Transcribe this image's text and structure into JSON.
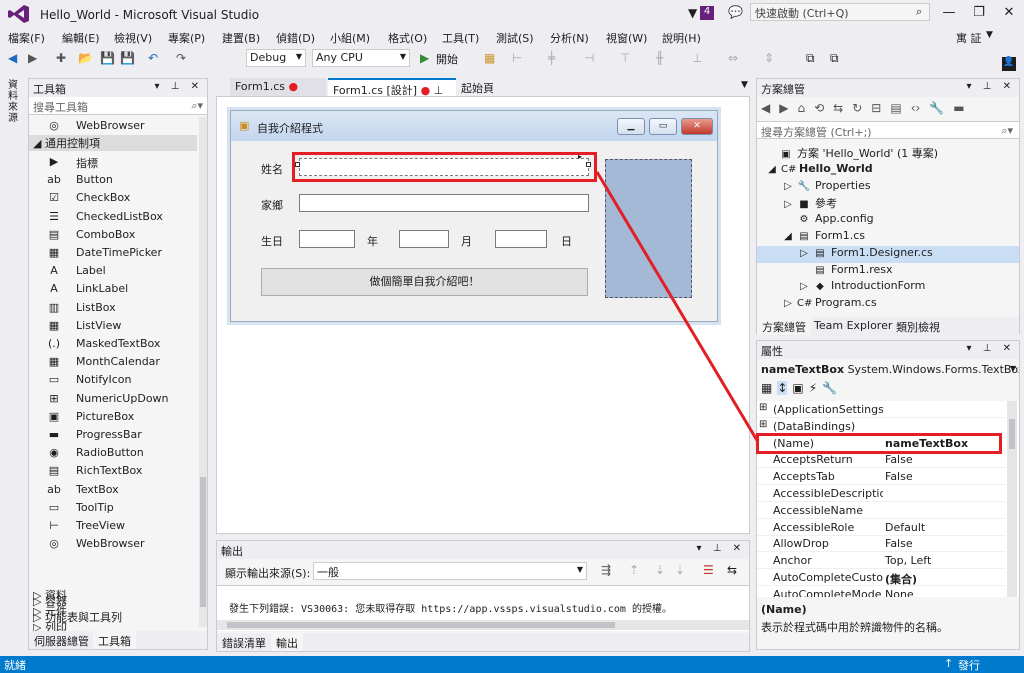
{
  "window": {
    "title": "Hello_World - Microsoft Visual Studio",
    "notif_count": "4",
    "quick_launch_placeholder": "快速啟動 (Ctrl+Q)",
    "user": "寓 証"
  },
  "menu": [
    "檔案(F)",
    "編輯(E)",
    "檢視(V)",
    "專案(P)",
    "建置(B)",
    "偵錯(D)",
    "小組(M)",
    "格式(O)",
    "工具(T)",
    "測試(S)",
    "分析(N)",
    "視窗(W)",
    "說明(H)"
  ],
  "toolbar": {
    "config": "Debug",
    "platform": "Any CPU",
    "start_label": "開始"
  },
  "left_strip_label": "資料來源",
  "toolbox": {
    "title": "工具箱",
    "search_placeholder": "搜尋工具箱",
    "top_item": "WebBrowser",
    "group_common": "◢ 通用控制項",
    "items": [
      {
        "icon": "▶",
        "label": "指標",
        "icon_name": "pointer-icon"
      },
      {
        "icon": "ab",
        "label": "Button",
        "icon_name": "button-icon"
      },
      {
        "icon": "☑",
        "label": "CheckBox",
        "icon_name": "checkbox-icon"
      },
      {
        "icon": "☰",
        "label": "CheckedListBox",
        "icon_name": "checkedlistbox-icon"
      },
      {
        "icon": "▤",
        "label": "ComboBox",
        "icon_name": "combobox-icon"
      },
      {
        "icon": "▦",
        "label": "DateTimePicker",
        "icon_name": "datetimepicker-icon"
      },
      {
        "icon": "A",
        "label": "Label",
        "icon_name": "label-icon"
      },
      {
        "icon": "A",
        "label": "LinkLabel",
        "icon_name": "linklabel-icon"
      },
      {
        "icon": "▥",
        "label": "ListBox",
        "icon_name": "listbox-icon"
      },
      {
        "icon": "▦",
        "label": "ListView",
        "icon_name": "listview-icon"
      },
      {
        "icon": "(.)",
        "label": "MaskedTextBox",
        "icon_name": "maskedtextbox-icon"
      },
      {
        "icon": "▦",
        "label": "MonthCalendar",
        "icon_name": "monthcalendar-icon"
      },
      {
        "icon": "▭",
        "label": "NotifyIcon",
        "icon_name": "notifyicon-icon"
      },
      {
        "icon": "⊞",
        "label": "NumericUpDown",
        "icon_name": "numericupdown-icon"
      },
      {
        "icon": "▣",
        "label": "PictureBox",
        "icon_name": "picturebox-icon"
      },
      {
        "icon": "▬",
        "label": "ProgressBar",
        "icon_name": "progressbar-icon"
      },
      {
        "icon": "◉",
        "label": "RadioButton",
        "icon_name": "radiobutton-icon"
      },
      {
        "icon": "▤",
        "label": "RichTextBox",
        "icon_name": "richtextbox-icon"
      },
      {
        "icon": "ab",
        "label": "TextBox",
        "icon_name": "textbox-icon"
      },
      {
        "icon": "▭",
        "label": "ToolTip",
        "icon_name": "tooltip-icon"
      },
      {
        "icon": "⊢",
        "label": "TreeView",
        "icon_name": "treeview-icon"
      },
      {
        "icon": "◎",
        "label": "WebBrowser",
        "icon_name": "webbrowser-icon"
      }
    ],
    "groups": [
      "▷ 容器",
      "▷ 功能表與工具列",
      "▷ 資料",
      "▷ 元件",
      "▷ 列印"
    ],
    "bottom_tabs": [
      "伺服器總管",
      "工具箱"
    ]
  },
  "doc_tabs": [
    "Form1.cs",
    "Form1.cs [設計]",
    "起始頁"
  ],
  "form": {
    "title": "自我介紹程式",
    "labels": {
      "name": "姓名",
      "home": "家鄉",
      "birth": "生日",
      "year": "年",
      "month": "月",
      "day": "日"
    },
    "button": "做個簡單自我介紹吧！"
  },
  "output": {
    "title": "輸出",
    "source_label": "顯示輸出來源(S):",
    "source_value": "一般",
    "message": "發生下列錯誤: VS30063: 您未取得存取 https://app.vssps.visualstudio.com 的授權。",
    "tabs": [
      "錯誤清單",
      "輸出"
    ]
  },
  "solution": {
    "title": "方案總管",
    "search_placeholder": "搜尋方案總管 (Ctrl+;)",
    "nodes": [
      {
        "label": "方案 'Hello_World' (1 專案)",
        "icon": "▣",
        "expander": ""
      },
      {
        "label": "Hello_World",
        "icon": "C#",
        "expander": "◢"
      },
      {
        "label": "Properties",
        "icon": "🔧",
        "expander": "▷"
      },
      {
        "label": "參考",
        "icon": "■",
        "expander": "▷"
      },
      {
        "label": "App.config",
        "icon": "⚙",
        "expander": ""
      },
      {
        "label": "Form1.cs",
        "icon": "▤",
        "expander": "◢"
      },
      {
        "label": "Form1.Designer.cs",
        "icon": "▤",
        "expander": "▷"
      },
      {
        "label": "Form1.resx",
        "icon": "▤",
        "expander": ""
      },
      {
        "label": "IntroductionForm",
        "icon": "◆",
        "expander": "▷"
      },
      {
        "label": "Program.cs",
        "icon": "C#",
        "expander": "▷"
      }
    ],
    "tabs": [
      "方案總管",
      "Team Explorer",
      "類別檢視"
    ]
  },
  "properties": {
    "title": "屬性",
    "object": "nameTextBox",
    "object_type": "System.Windows.Forms.TextBox",
    "rows": [
      {
        "name": "(ApplicationSettings)",
        "value": "",
        "expand": "⊞"
      },
      {
        "name": "(DataBindings)",
        "value": "",
        "expand": "⊞"
      },
      {
        "name": "(Name)",
        "value": "nameTextBox",
        "expand": ""
      },
      {
        "name": "AcceptsReturn",
        "value": "False",
        "expand": ""
      },
      {
        "name": "AcceptsTab",
        "value": "False",
        "expand": ""
      },
      {
        "name": "AccessibleDescription",
        "value": "",
        "expand": ""
      },
      {
        "name": "AccessibleName",
        "value": "",
        "expand": ""
      },
      {
        "name": "AccessibleRole",
        "value": "Default",
        "expand": ""
      },
      {
        "name": "AllowDrop",
        "value": "False",
        "expand": ""
      },
      {
        "name": "Anchor",
        "value": "Top, Left",
        "expand": ""
      },
      {
        "name": "AutoCompleteCustom",
        "value": "(集合)",
        "expand": ""
      },
      {
        "name": "AutoCompleteMode",
        "value": "None",
        "expand": ""
      }
    ],
    "desc_title": "(Name)",
    "desc_text": "表示於程式碼中用於辨識物件的名稱。"
  },
  "status": {
    "left": "就緒",
    "right": "發行"
  },
  "colors": {
    "accent": "#007acc",
    "annotation": "#e31e24",
    "selection": "#c9def5"
  }
}
